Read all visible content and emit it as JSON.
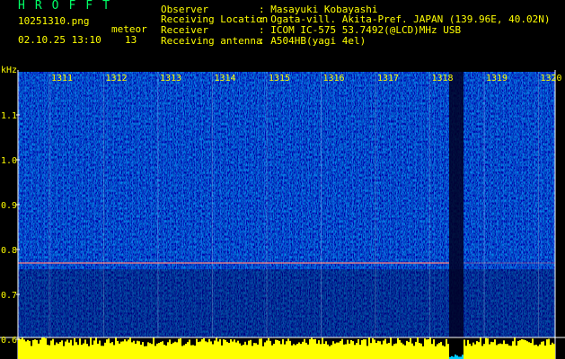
{
  "header": {
    "brand": "HROFFT",
    "filename": "10251310.png",
    "datetime": "02.10.25 13:10",
    "meteor_label": "meteor",
    "meteor_count": "13",
    "fields": [
      {
        "label": "Observer",
        "value": ": Masayuki Kobayashi"
      },
      {
        "label": "Receiving Location",
        "value": ": Ogata-vill. Akita-Pref. JAPAN (139.96E, 40.02N)"
      },
      {
        "label": "Receiver",
        "value": ": ICOM IC-575 53.7492(@LCD)MHz USB"
      },
      {
        "label": "Receiving antenna",
        "value": ": A504HB(yagi 4el)"
      }
    ]
  },
  "spectrogram": {
    "y_unit": "kHz",
    "y_ticks": [
      "1.1",
      "1.0",
      "0.9",
      "0.8",
      "0.7",
      "0.6"
    ],
    "time_labels": [
      "1311",
      "1312",
      "1313",
      "1314",
      "1315",
      "1316",
      "1317",
      "1318",
      "1319",
      "1320"
    ]
  },
  "colors": {
    "text_yellow": "#ffff00",
    "text_green": "#00ff66",
    "background": "#000000",
    "spectrogram_base": "#0a1a8c",
    "signal_line": "#ff8080",
    "level_bar": "#ffff00",
    "grid": "#ffffff"
  }
}
